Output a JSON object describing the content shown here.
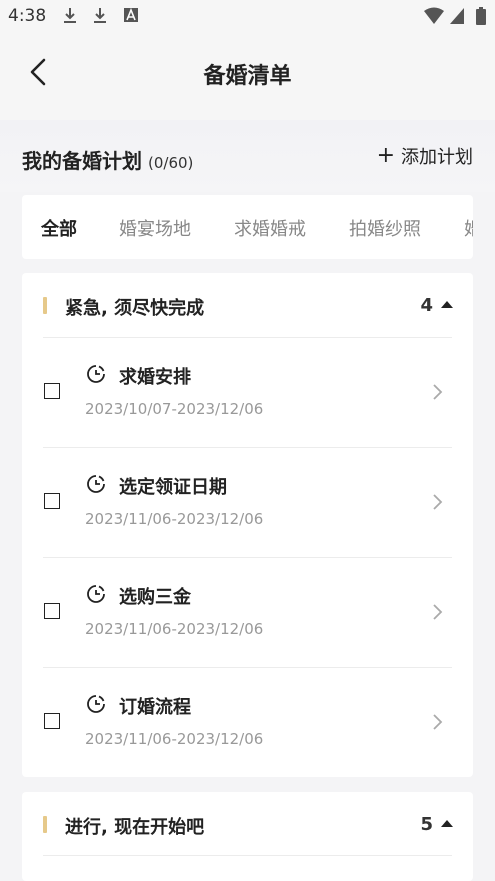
{
  "status_bar": {
    "time": "4:38"
  },
  "nav": {
    "title": "备婚清单"
  },
  "plan": {
    "title": "我的备婚计划",
    "count": "(0/60)",
    "add_label": "添加计划",
    "add_plus": "+"
  },
  "tabs": [
    {
      "label": "全部"
    },
    {
      "label": "婚宴场地"
    },
    {
      "label": "求婚婚戒"
    },
    {
      "label": "拍婚纱照"
    },
    {
      "label": "婚"
    }
  ],
  "sections": [
    {
      "title": "紧急, 须尽快完成",
      "count": "4",
      "tasks": [
        {
          "title": "求婚安排",
          "date": "2023/10/07-2023/12/06"
        },
        {
          "title": "选定领证日期",
          "date": "2023/11/06-2023/12/06"
        },
        {
          "title": "选购三金",
          "date": "2023/11/06-2023/12/06"
        },
        {
          "title": "订婚流程",
          "date": "2023/11/06-2023/12/06"
        }
      ]
    },
    {
      "title": "进行, 现在开始吧",
      "count": "5",
      "tasks": []
    }
  ],
  "colors": {
    "accent": "#e6c98a",
    "background": "#f4f4f6"
  }
}
